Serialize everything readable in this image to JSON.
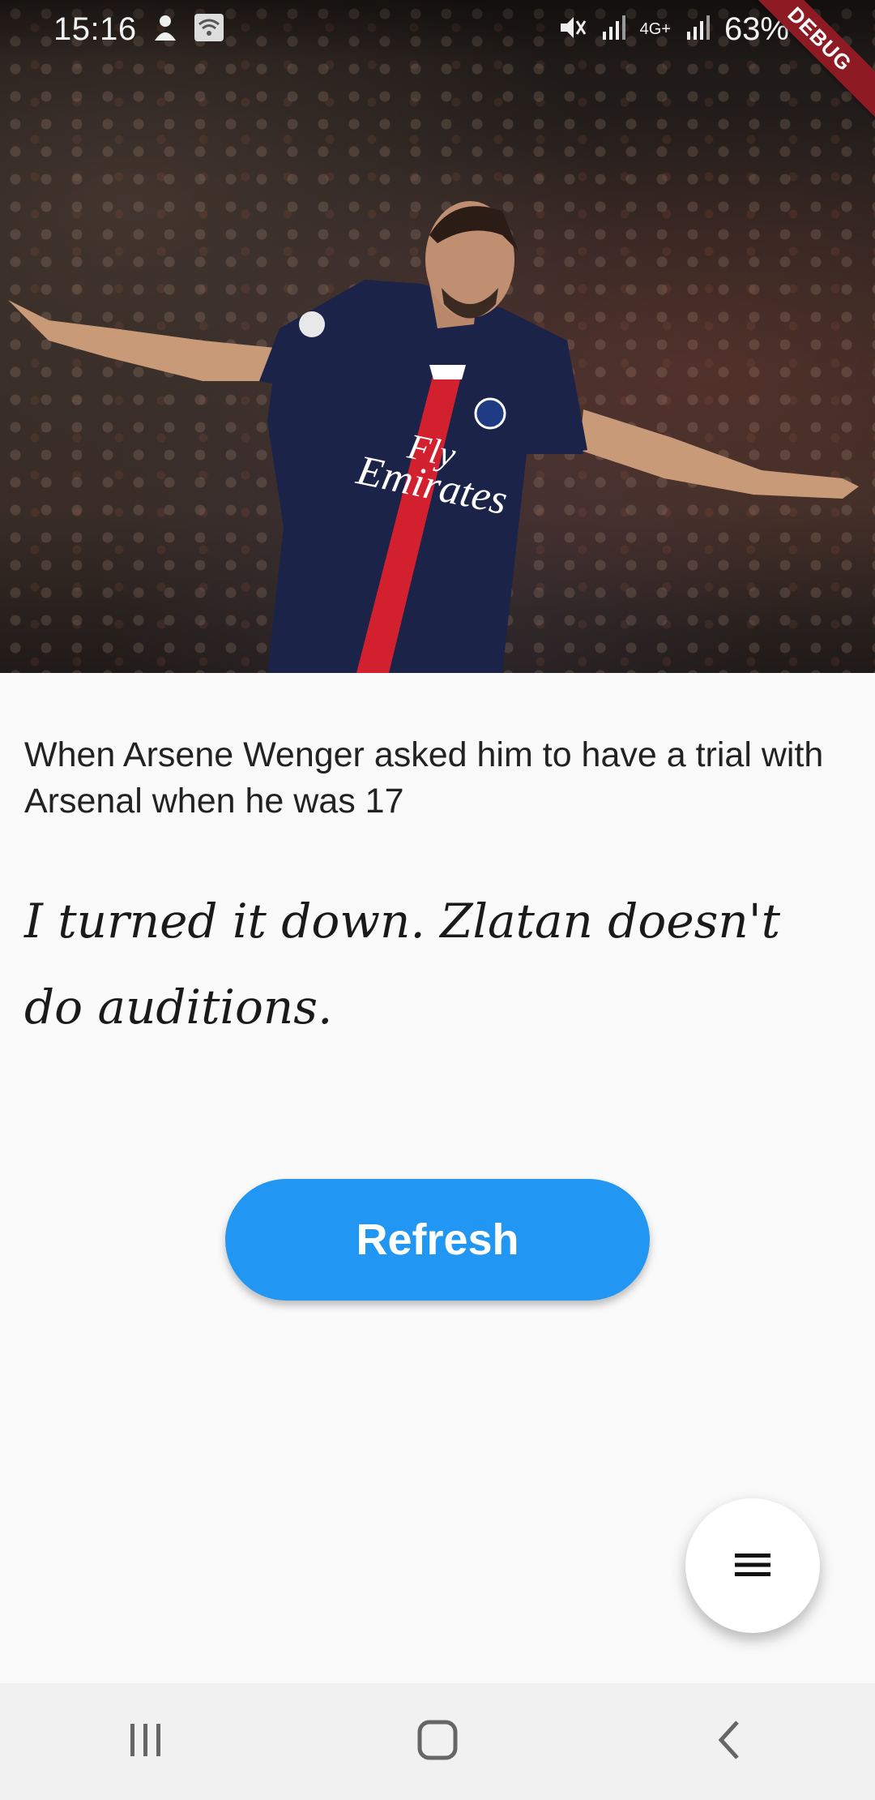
{
  "status_bar": {
    "time": "15:16",
    "network_type": "4G+",
    "battery": "63%"
  },
  "debug_banner": "DEBUG",
  "hero": {
    "jersey_text": "Fly Emirates"
  },
  "content": {
    "question": "When Arsene Wenger asked him to have a trial with Arsenal when he was 17",
    "quote": "I turned it down. Zlatan doesn't do auditions."
  },
  "actions": {
    "refresh_label": "Refresh",
    "fab_icon": "menu-icon"
  },
  "nav_bar": {
    "icons": [
      "recent-apps-icon",
      "home-icon",
      "back-icon"
    ]
  },
  "colors": {
    "accent": "#2196f3",
    "debug": "#8e1b23",
    "jersey": "#1c2348",
    "jersey_stripe": "#d3202e"
  }
}
